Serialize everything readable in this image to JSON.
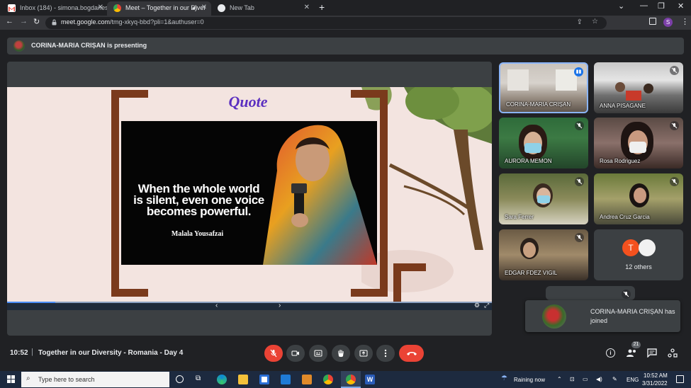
{
  "browser": {
    "tabs": [
      {
        "label": "Inbox (184) - simona.bogdanesc",
        "active": false
      },
      {
        "label": "Meet – Together in our Diver",
        "active": true
      },
      {
        "label": "New Tab",
        "active": false
      }
    ],
    "url_host": "meet.google.com",
    "url_path": "/tmg-xkyq-bbd?pli=1&authuser=0",
    "profile_initial": "S"
  },
  "meet": {
    "presenting_text": "CORINA-MARIA CRIȘAN is presenting",
    "slide": {
      "heading": "Quote",
      "quote": "When the whole world is silent, even one voice becomes powerful.",
      "quote_line1": "When the whole world",
      "quote_line2": "is silent, even one voice",
      "quote_line3": "becomes powerful.",
      "author": "Malala Yousafzai"
    },
    "participants": [
      {
        "name": "CORINA-MARIA CRIȘAN",
        "speaking": true
      },
      {
        "name": "ANNA PISAGANE",
        "muted": true
      },
      {
        "name": "AURORA MEMON",
        "muted": true
      },
      {
        "name": "Rosa Rodriguez",
        "muted": true
      },
      {
        "name": "Sara Ferrer",
        "muted": true
      },
      {
        "name": "Andrea Cruz Garcia",
        "muted": true
      },
      {
        "name": "EDGAR FDEZ VIGIL",
        "muted": true
      }
    ],
    "others": {
      "initial": "T",
      "label": "12 others"
    },
    "toast": "CORINA-MARIA CRIȘAN has joined",
    "toast_line1": "CORINA-MARIA CRIȘAN has",
    "toast_line2": "joined",
    "clock": "10:52",
    "meeting_title": "Together in our Diversity - Romania - Day 4",
    "people_count": "21",
    "colors": {
      "end_call": "#ea4335",
      "mic_off": "#ea4335",
      "accent": "#8ab4f8"
    }
  },
  "taskbar": {
    "search_placeholder": "Type here to search",
    "weather": "Raining now",
    "language": "ENG",
    "time": "10:52 AM",
    "date": "3/31/2022"
  }
}
